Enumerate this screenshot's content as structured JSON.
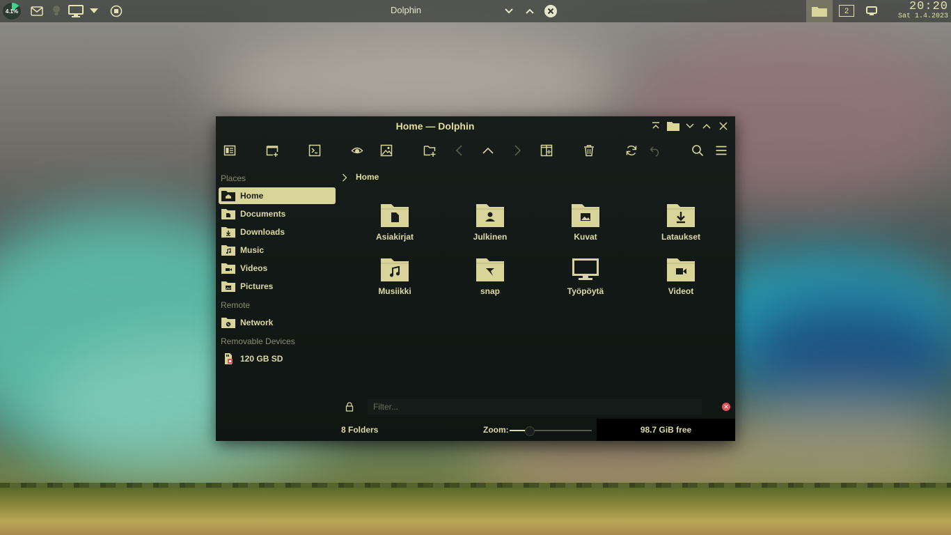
{
  "panel": {
    "battery_label": "4.1%",
    "battery_level_percent": 15,
    "active_window_title": "Dolphin",
    "virtual_desktop": "2",
    "clock_time": "20:20",
    "clock_date": "Sat 1.4.2023"
  },
  "window": {
    "title": "Home — Dolphin"
  },
  "sidebar": {
    "places_heading": "Places",
    "places": [
      {
        "label": "Home",
        "icon": "home-folder-icon"
      },
      {
        "label": "Documents",
        "icon": "documents-folder-icon"
      },
      {
        "label": "Downloads",
        "icon": "downloads-folder-icon"
      },
      {
        "label": "Music",
        "icon": "music-folder-icon"
      },
      {
        "label": "Videos",
        "icon": "videos-folder-icon"
      },
      {
        "label": "Pictures",
        "icon": "pictures-folder-icon"
      }
    ],
    "remote_heading": "Remote",
    "remote": [
      {
        "label": "Network",
        "icon": "network-folder-icon"
      }
    ],
    "removable_heading": "Removable Devices",
    "removable": [
      {
        "label": "120 GB SD",
        "icon": "sd-card-icon"
      }
    ]
  },
  "breadcrumb": {
    "current": "Home"
  },
  "items": [
    {
      "name": "Asiakirjat",
      "icon": "documents-folder-icon"
    },
    {
      "name": "Julkinen",
      "icon": "public-folder-icon"
    },
    {
      "name": "Kuvat",
      "icon": "pictures-folder-icon"
    },
    {
      "name": "Lataukset",
      "icon": "downloads-folder-icon"
    },
    {
      "name": "Musiikki",
      "icon": "music-folder-icon"
    },
    {
      "name": "snap",
      "icon": "snap-folder-icon"
    },
    {
      "name": "Työpöytä",
      "icon": "desktop-monitor-icon"
    },
    {
      "name": "Videot",
      "icon": "videos-folder-icon"
    }
  ],
  "filter": {
    "placeholder": "Filter...",
    "value": ""
  },
  "status": {
    "folder_count": "8 Folders",
    "zoom_label": "Zoom:",
    "zoom_fraction": 0.24,
    "free_space": "98.7 GiB free"
  },
  "colors": {
    "accent": "#ddd9a4",
    "selection_bg": "#d9d49a",
    "window_bg": "#121815",
    "clear_button": "#e0525a"
  }
}
